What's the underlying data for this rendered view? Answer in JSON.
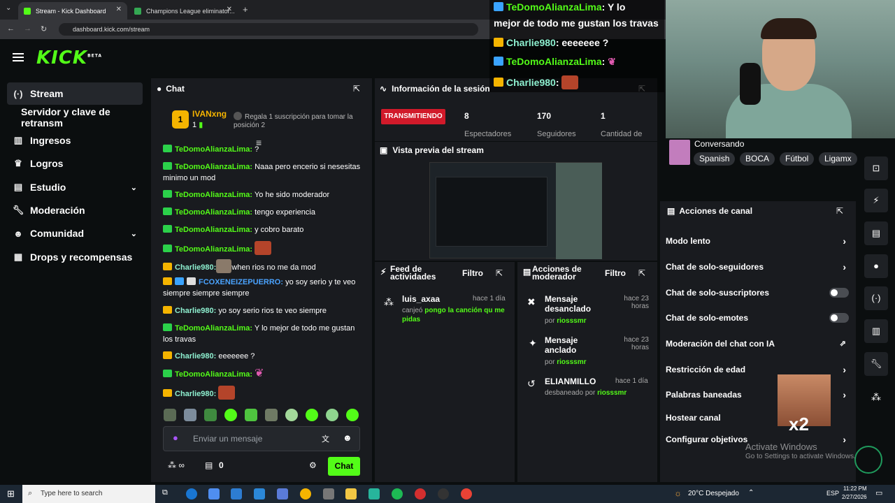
{
  "browser": {
    "tabs": [
      {
        "label": "Stream - Kick Dashboard"
      },
      {
        "label": "Champions League eliminator..."
      }
    ],
    "url": "dashboard.kick.com/stream"
  },
  "brand": {
    "logo": "KICK",
    "beta": "BETA"
  },
  "sidebar": {
    "items": [
      {
        "label": "Stream",
        "icon": "broadcast-icon"
      },
      {
        "label": "Servidor y clave de retransm",
        "icon": ""
      },
      {
        "label": "Ingresos",
        "icon": "chart-icon"
      },
      {
        "label": "Logros",
        "icon": "trophy-icon"
      },
      {
        "label": "Estudio",
        "icon": "studio-icon"
      },
      {
        "label": "Moderación",
        "icon": "wrench-icon"
      },
      {
        "label": "Comunidad",
        "icon": "users-icon"
      },
      {
        "label": "Drops y recompensas",
        "icon": "drops-icon"
      }
    ]
  },
  "chat": {
    "title": "Chat",
    "top_gifter": {
      "name": "IVANxng",
      "rank": "1",
      "count": "1"
    },
    "gift_prompt": "Regala 1 suscripción para tomar la posición 2",
    "messages": [
      {
        "user": "TeDomoAlianzaLima:",
        "text": "?"
      },
      {
        "user": "TeDomoAlianzaLima:",
        "text": "Naaa pero encerio si nesesitas minimo un mod"
      },
      {
        "user": "TeDomoAlianzaLima:",
        "text": "Yo he sido moderador"
      },
      {
        "user": "TeDomoAlianzaLima:",
        "text": "tengo experiencia"
      },
      {
        "user": "TeDomoAlianzaLima:",
        "text": "y cobro barato"
      },
      {
        "user": "TeDomoAlianzaLima:",
        "text": ""
      },
      {
        "user": "Charlie980:",
        "text": "when rios no me da mod"
      },
      {
        "user": "FCOXENEIZEPUERRO:",
        "text": "yo soy serio y te veo siempre siempre siempre"
      },
      {
        "user": "Charlie980:",
        "text": "yo soy serio rios te veo siempre"
      },
      {
        "user": "TeDomoAlianzaLima:",
        "text": "Y lo mejor de todo me gustan los travas"
      },
      {
        "user": "Charlie980:",
        "text": "eeeeeee ?"
      },
      {
        "user": "TeDomoAlianzaLima:",
        "text": ""
      },
      {
        "user": "Charlie980:",
        "text": ""
      }
    ],
    "input_placeholder": "Enviar un mensaje",
    "points": "0",
    "send_label": "Chat"
  },
  "session": {
    "title": "Información de la sesión",
    "status": "TRANSMITIENDO",
    "stats": [
      {
        "value": "8",
        "label": "Espectadores"
      },
      {
        "value": "170",
        "label": "Seguidores"
      },
      {
        "value": "1",
        "label": "Cantidad de"
      }
    ]
  },
  "preview": {
    "title": "Vista previa del stream"
  },
  "feed": {
    "title": "Feed de actividades",
    "filter": "Filtro",
    "items": [
      {
        "user": "luis_axaa",
        "time": "hace 1 día",
        "action": "canjeó",
        "reward": "pongo la canción qu me pidas"
      }
    ]
  },
  "modactions": {
    "title": "Acciones de moderador",
    "filter": "Filtro",
    "items": [
      {
        "action": "Mensaje desanclado",
        "by": "por",
        "mod": "riosssmr",
        "time": "hace 23 horas"
      },
      {
        "action": "Mensaje anclado",
        "by": "por",
        "mod": "riosssmr",
        "time": "hace 23 horas"
      },
      {
        "action": "ELIANMILLO",
        "by": "desbaneado por",
        "mod": "riosssmr",
        "time": "hace 1 día"
      }
    ]
  },
  "overlay": {
    "lines": [
      {
        "user": "TeDomoAlianzaLima",
        "text": ": Y lo"
      },
      {
        "user": "",
        "text": "mejor de todo me gustan los travas"
      },
      {
        "user": "Charlie980",
        "text": ": eeeeeee ?"
      },
      {
        "user": "TeDomoAlianzaLima",
        "text": ":"
      },
      {
        "user": "Charlie980",
        "text": ":"
      }
    ]
  },
  "category": {
    "name": "Conversando",
    "tags": [
      "Spanish",
      "BOCA",
      "Fútbol",
      "Ligamx"
    ]
  },
  "channel_actions": {
    "title": "Acciones de canal",
    "items": [
      {
        "label": "Modo lento",
        "control": "arrow"
      },
      {
        "label": "Chat de solo-seguidores",
        "control": "arrow"
      },
      {
        "label": "Chat de solo-suscriptores",
        "control": "toggle"
      },
      {
        "label": "Chat de solo-emotes",
        "control": "toggle"
      },
      {
        "label": "Moderación del chat con IA",
        "control": "external"
      },
      {
        "label": "Restricción de edad",
        "control": "arrow"
      },
      {
        "label": "Palabras baneadas",
        "control": "arrow"
      },
      {
        "label": "Hostear canal",
        "control": "none"
      },
      {
        "label": "Configurar objetivos",
        "control": "arrow"
      }
    ]
  },
  "meme": {
    "label": "x2"
  },
  "watermark": {
    "line1": "Activate Windows",
    "line2": "Go to Settings to activate Windows."
  },
  "taskbar": {
    "search_placeholder": "Type here to search",
    "weather": "20°C  Despejado",
    "lang": "ESP",
    "time": "11:22 PM",
    "date": "2/27/2026"
  },
  "colors": {
    "accent": "#53fc18",
    "live": "#d11a2a",
    "panel": "#191b1f"
  }
}
